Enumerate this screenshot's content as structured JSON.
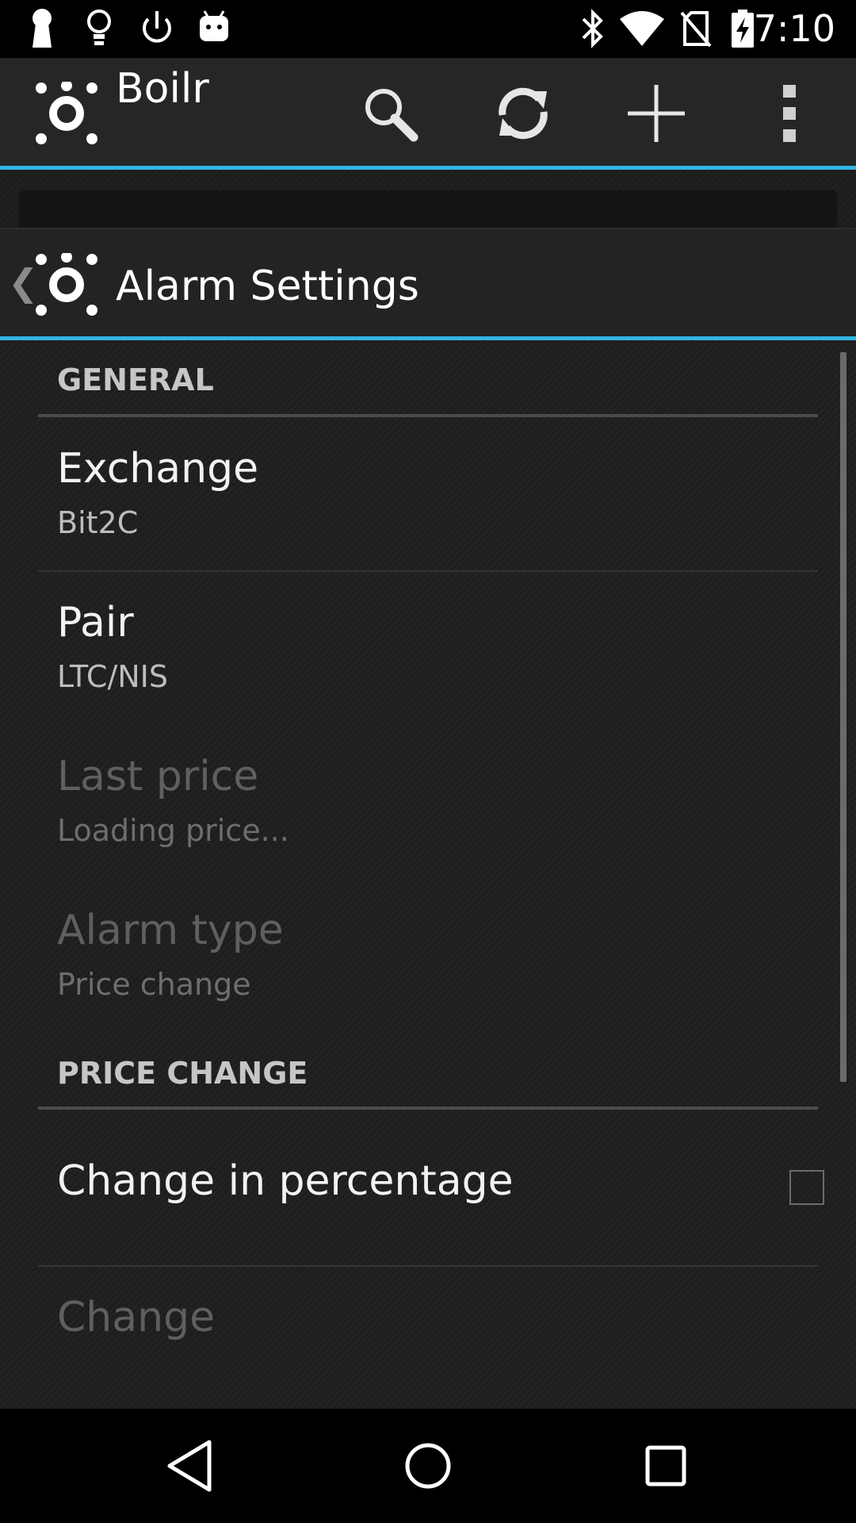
{
  "status_bar": {
    "time": "7:10",
    "left_icons": [
      "keyhole-icon",
      "lightbulb-icon",
      "power-icon",
      "android-icon"
    ],
    "right_icons": [
      "bluetooth-icon",
      "wifi-icon",
      "no-sim-icon",
      "battery-charging-icon"
    ]
  },
  "app_bar": {
    "title": "Boilr",
    "actions": [
      "search-icon",
      "refresh-icon",
      "add-icon",
      "overflow-menu-icon"
    ],
    "accent_color": "#33b5e5"
  },
  "preferences": {
    "title": "Alarm Settings",
    "categories": [
      {
        "label": "GENERAL",
        "items": [
          {
            "title": "Exchange",
            "summary": "Bit2C",
            "enabled": true
          },
          {
            "title": "Pair",
            "summary": "LTC/NIS",
            "enabled": true
          },
          {
            "title": "Last price",
            "summary": "Loading price...",
            "enabled": false
          },
          {
            "title": "Alarm type",
            "summary": "Price change",
            "enabled": false
          }
        ]
      },
      {
        "label": "PRICE CHANGE",
        "items": [
          {
            "title": "Change in percentage",
            "checked": false,
            "enabled": true
          },
          {
            "title": "Change",
            "enabled": false
          }
        ]
      }
    ]
  },
  "nav_bar": {
    "buttons": [
      "back-icon",
      "home-icon",
      "recents-icon"
    ]
  }
}
